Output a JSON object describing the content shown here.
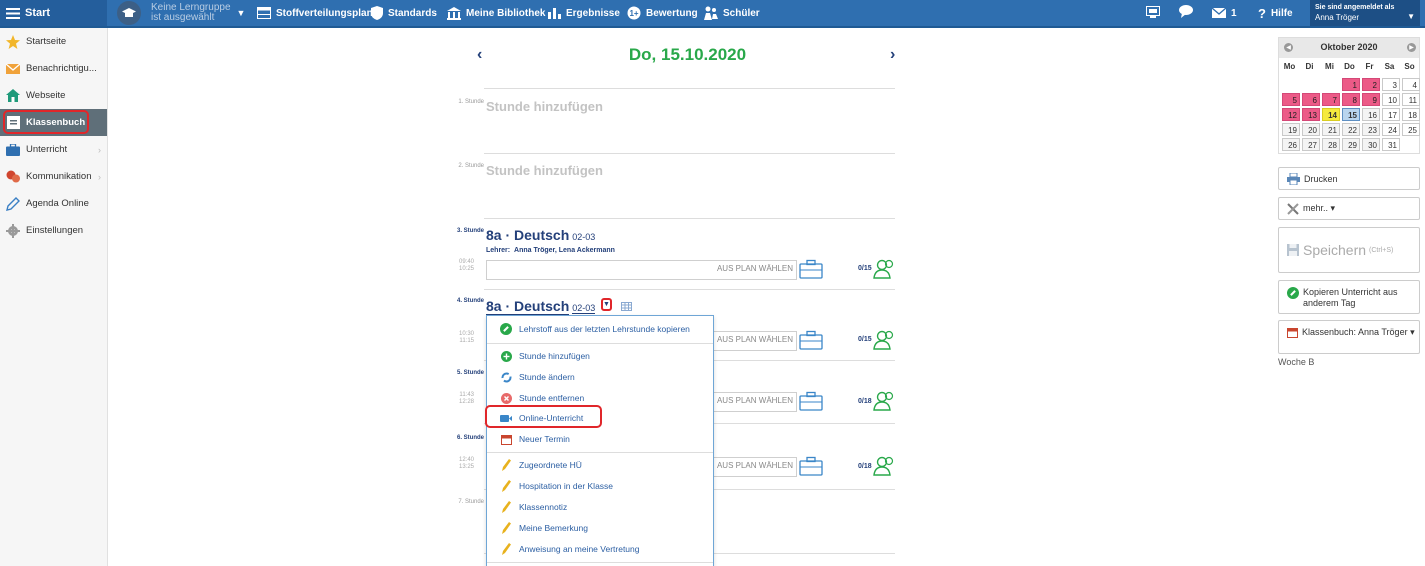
{
  "topbar": {
    "start_label": "Start",
    "group_line1": "Keine Lerngruppe",
    "group_line2": "ist ausgewählt",
    "nav": [
      {
        "label": "Stoffverteilungsplan",
        "icon": "table-icon"
      },
      {
        "label": "Standards",
        "icon": "shield-icon"
      },
      {
        "label": "Meine Bibliothek",
        "icon": "library-icon"
      },
      {
        "label": "Ergebnisse",
        "icon": "bar-chart-icon"
      },
      {
        "label": "Bewertung",
        "icon": "grade-icon"
      },
      {
        "label": "Schüler",
        "icon": "students-icon"
      }
    ],
    "mail_count": "1",
    "help_label": "Hilfe",
    "logged_in_label": "Sie sind angemeldet als",
    "user_name": "Anna Tröger"
  },
  "sidebar": {
    "items": [
      {
        "label": "Startseite",
        "icon": "star-icon"
      },
      {
        "label": "Benachrichtigu...",
        "icon": "envelope-icon"
      },
      {
        "label": "Webseite",
        "icon": "house-icon"
      },
      {
        "label": "Klassenbuch",
        "icon": "book-icon"
      },
      {
        "label": "Unterricht",
        "icon": "briefcase-icon"
      },
      {
        "label": "Kommunikation",
        "icon": "chat-icon"
      },
      {
        "label": "Agenda Online",
        "icon": "pencil-icon"
      },
      {
        "label": "Einstellungen",
        "icon": "gear-icon"
      }
    ]
  },
  "main": {
    "date": "Do, 15.10.2020",
    "add_lesson": "Stunde hinzufügen",
    "periods": [
      "1. Stunde",
      "2. Stunde",
      "3. Stunde",
      "4. Stunde",
      "5. Stunde",
      "6. Stunde",
      "7. Stunde"
    ],
    "lessons": [
      {
        "class": "8a · Deutsch",
        "room": "02-03",
        "teacher_label": "Lehrer:",
        "teachers": "Anna Tröger, Lena Ackermann",
        "time_start": "09:40",
        "time_end": "10:25",
        "plan": "AUS PLAN WÄHLEN",
        "count": "0/15"
      },
      {
        "class": "8a · Deutsch",
        "room": "02-03",
        "time_start": "10:30",
        "time_end": "11:15",
        "plan": "AUS PLAN WÄHLEN",
        "count": "0/15"
      },
      {
        "time_start": "11:43",
        "time_end": "12:28",
        "plan": "AUS PLAN WÄHLEN",
        "count": "0/18"
      },
      {
        "time_start": "12:40",
        "time_end": "13:25",
        "plan": "AUS PLAN WÄHLEN",
        "count": "0/18"
      }
    ],
    "menu": [
      {
        "label": "Lehrstoff aus der letzten Lehrstunde kopieren",
        "icon": "copy-icon"
      },
      {
        "label": "Stunde hinzufügen",
        "icon": "plus-circle-icon"
      },
      {
        "label": "Stunde ändern",
        "icon": "refresh-icon"
      },
      {
        "label": "Stunde entfernen",
        "icon": "remove-circle-icon"
      },
      {
        "label": "Online-Unterricht",
        "icon": "video-camera-icon"
      },
      {
        "label": "Neuer Termin",
        "icon": "calendar-icon"
      },
      {
        "label": "Zugeordnete HÜ",
        "icon": "pencil-icon"
      },
      {
        "label": "Hospitation in der Klasse",
        "icon": "pencil-icon"
      },
      {
        "label": "Klassennotiz",
        "icon": "pencil-icon"
      },
      {
        "label": "Meine Bemerkung",
        "icon": "pencil-icon"
      },
      {
        "label": "Anweisung an meine Vertretung",
        "icon": "pencil-icon"
      }
    ]
  },
  "calendar": {
    "month": "Oktober 2020",
    "weekdays": [
      "Mo",
      "Di",
      "Mi",
      "Do",
      "Fr",
      "Sa",
      "So"
    ],
    "weeks": [
      [
        "",
        "",
        "",
        "1",
        "2",
        "3",
        "4"
      ],
      [
        "5",
        "6",
        "7",
        "8",
        "9",
        "10",
        "11"
      ],
      [
        "12",
        "13",
        "14",
        "15",
        "16",
        "17",
        "18"
      ],
      [
        "19",
        "20",
        "21",
        "22",
        "23",
        "24",
        "25"
      ],
      [
        "26",
        "27",
        "28",
        "29",
        "30",
        "31",
        ""
      ]
    ],
    "highlighted_days": [
      "1",
      "2",
      "5",
      "6",
      "7",
      "8",
      "9",
      "12",
      "13"
    ],
    "holiday_day": "14",
    "selected_day": "15",
    "colors": {
      "highlight": "#ec5a87",
      "holiday": "#f5ea3d",
      "selected": "#b9d5ee"
    }
  },
  "rightpanel": {
    "print": "Drucken",
    "more": "mehr.. ▾",
    "save": "Speichern",
    "save_shortcut": "(Ctrl+S)",
    "copy_lesson": "Kopieren Unterricht aus anderem Tag",
    "classbook": "Klassenbuch: Anna Tröger ▾",
    "week": "Woche B"
  },
  "colors": {
    "topbar": "#2f6fb0",
    "accent_navy": "#24407a",
    "date_green": "#29a84a",
    "highlight_red": "#e0262a"
  }
}
